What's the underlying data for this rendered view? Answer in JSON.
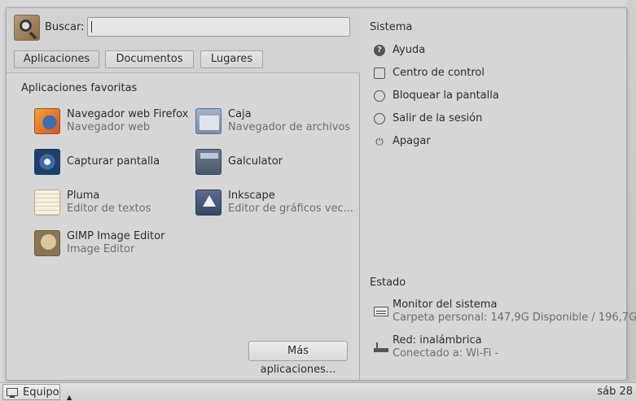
{
  "search": {
    "label": "Buscar:",
    "value": "",
    "placeholder": ""
  },
  "tabs": [
    {
      "label": "Aplicaciones",
      "active": true
    },
    {
      "label": "Documentos",
      "active": false
    },
    {
      "label": "Lugares",
      "active": false
    }
  ],
  "favorites": {
    "title": "Aplicaciones favoritas",
    "apps": [
      {
        "name": "Navegador web Firefox",
        "description": "Navegador web",
        "icon": "firefox-icon"
      },
      {
        "name": "Caja",
        "description": "Navegador de archivos",
        "icon": "file-manager-icon"
      },
      {
        "name": "Capturar pantalla",
        "description": "",
        "icon": "screenshot-icon"
      },
      {
        "name": "Galculator",
        "description": "",
        "icon": "calculator-icon"
      },
      {
        "name": "Pluma",
        "description": "Editor de textos",
        "icon": "text-editor-icon"
      },
      {
        "name": "Inkscape",
        "description": "Editor de gráficos vec...",
        "icon": "inkscape-icon"
      },
      {
        "name": "GIMP Image Editor",
        "description": "Image Editor",
        "icon": "gimp-icon"
      }
    ],
    "more_button": "Más aplicaciones..."
  },
  "system": {
    "title": "Sistema",
    "items": [
      {
        "label": "Ayuda",
        "icon": "help-icon"
      },
      {
        "label": "Centro de control",
        "icon": "control-center-icon"
      },
      {
        "label": "Bloquear la pantalla",
        "icon": "lock-icon"
      },
      {
        "label": "Salir de la sesión",
        "icon": "logout-icon"
      },
      {
        "label": "Apagar",
        "icon": "power-icon"
      }
    ]
  },
  "status": {
    "title": "Estado",
    "items": [
      {
        "name": "Monitor del sistema",
        "detail": "Carpeta personal: 147,9G Disponible / 196,7G",
        "icon": "system-monitor-icon"
      },
      {
        "name": "Red: inalámbrica",
        "detail": "Conectado a: Wi-Fi -",
        "icon": "network-icon"
      }
    ]
  },
  "panel": {
    "menu_label": "Equipo",
    "clock": "sáb 28"
  }
}
